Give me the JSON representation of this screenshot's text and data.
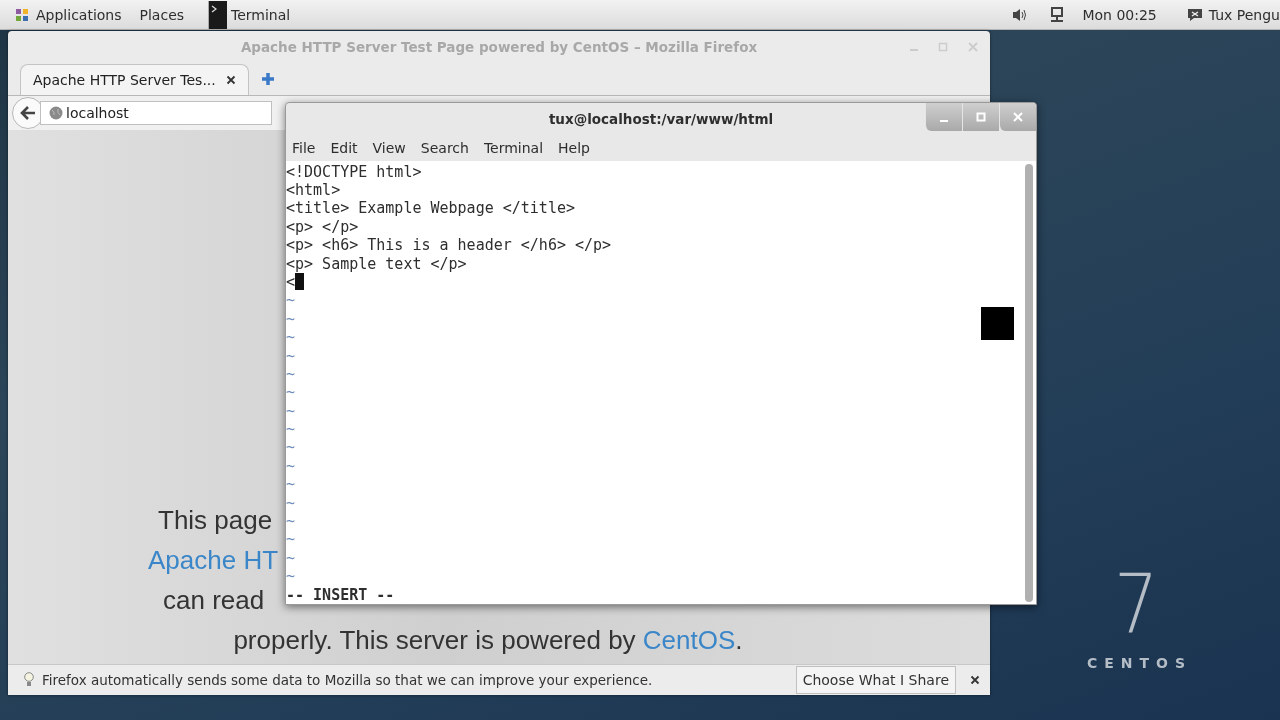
{
  "top_bar": {
    "menus": [
      "Applications",
      "Places"
    ],
    "task": "Terminal",
    "clock": "Mon 00:25",
    "user": "Tux Pengu"
  },
  "firefox": {
    "title": "Apache HTTP Server Test Page powered by CentOS – Mozilla Firefox",
    "tabs": [
      {
        "label": "Apache HTTP Server Tes...",
        "selected": true
      }
    ],
    "url": "localhost",
    "content_lines": [
      [
        {
          "kind": "text",
          "text": "This page"
        }
      ],
      [
        {
          "kind": "link",
          "text": "Apache HT"
        }
      ],
      [
        {
          "kind": "text",
          "text": "can read"
        }
      ],
      [
        {
          "kind": "text",
          "text": "properly. This server is powered by "
        },
        {
          "kind": "link",
          "text": "CentOS"
        },
        {
          "kind": "text",
          "text": "."
        }
      ]
    ],
    "notification": {
      "text": "Firefox automatically sends some data to Mozilla so that we can improve your experience.",
      "button": "Choose What I Share"
    }
  },
  "terminal": {
    "title": "tux@localhost:/var/www/html",
    "menu": [
      "File",
      "Edit",
      "View",
      "Search",
      "Terminal",
      "Help"
    ],
    "lines": [
      "<!DOCTYPE html>",
      "<html>",
      "<title> Example Webpage </title>",
      "<p> </p>",
      "<p> <h6> This is a header </h6> </p>",
      "<p> Sample text </p>"
    ],
    "cursor_line": "<",
    "filler": [
      "~",
      "~",
      "~",
      "~",
      "~",
      "~",
      "~",
      "~",
      "~",
      "~",
      "~",
      "~",
      "~",
      "~",
      "~",
      "~"
    ],
    "status": "-- INSERT --"
  },
  "desktop": {
    "logo_number": "7",
    "logo_text": "CENTOS"
  }
}
